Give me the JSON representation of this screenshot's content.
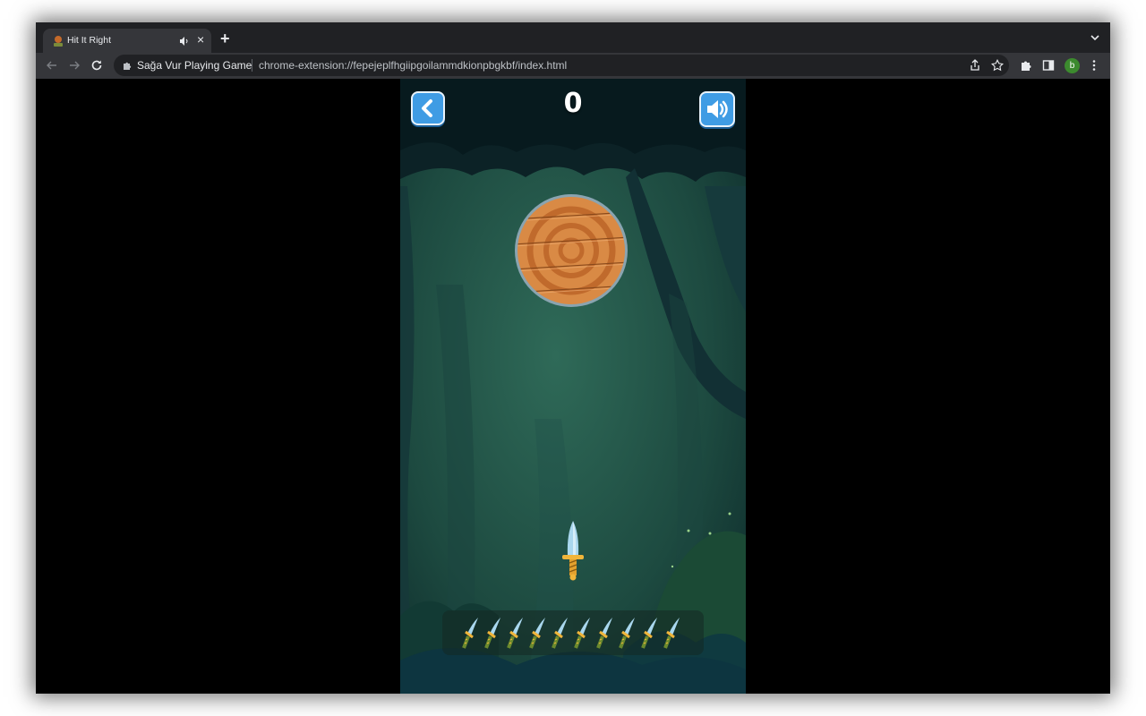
{
  "browser": {
    "tab": {
      "title": "Hit It Right",
      "audio_icon": "speaker-icon",
      "close_label": "×"
    },
    "new_tab_label": "+",
    "toolbar": {
      "site_name": "Sağa Vur Playing Game",
      "url": "chrome-extension://fepejeplfhgiipgoilammdkionpbgkbf/index.html",
      "avatar_letter": "b"
    }
  },
  "game": {
    "score": "0",
    "back_button_icon": "chevron-left-icon",
    "sound_button_icon": "speaker-on-icon",
    "knives_remaining": 10,
    "colors": {
      "button": "#3f9ce4",
      "target": "#d98a45",
      "blade": "#a9d7ee",
      "hilt": "#f1b53a"
    }
  }
}
